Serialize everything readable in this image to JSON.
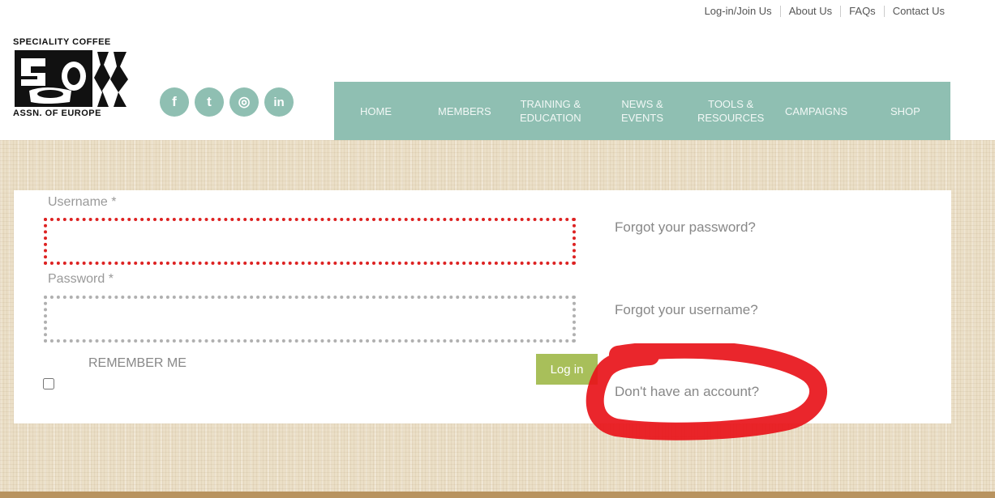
{
  "toplinks": {
    "login_join": "Log-in/Join Us",
    "about": "About Us",
    "faqs": "FAQs",
    "contact": "Contact Us"
  },
  "logo": {
    "top_text": "SPECIALITY COFFEE",
    "bottom_text": "ASSN. OF EUROPE"
  },
  "social": {
    "facebook": "f",
    "twitter": "t",
    "instagram": "◎",
    "linkedin": "in"
  },
  "nav": {
    "home": "HOME",
    "members": "MEMBERS",
    "training_1": "TRAINING &",
    "training_2": "EDUCATION",
    "news_1": "NEWS &",
    "news_2": "EVENTS",
    "tools_1": "TOOLS &",
    "tools_2": "RESOURCES",
    "campaigns": "CAMPAIGNS",
    "shop": "SHOP"
  },
  "form": {
    "username_label": "Username *",
    "password_label": "Password *",
    "username_value": "",
    "password_value": "",
    "remember_label": "REMEMBER ME",
    "login_button": "Log in",
    "forgot_password": "Forgot your password?",
    "forgot_username": "Forgot your username?",
    "no_account": "Don't have an account?"
  },
  "colors": {
    "nav_bg": "#8fbfb2",
    "login_button": "#a8bf5a",
    "username_border": "#dd2222",
    "annotation": "#e8141a"
  }
}
